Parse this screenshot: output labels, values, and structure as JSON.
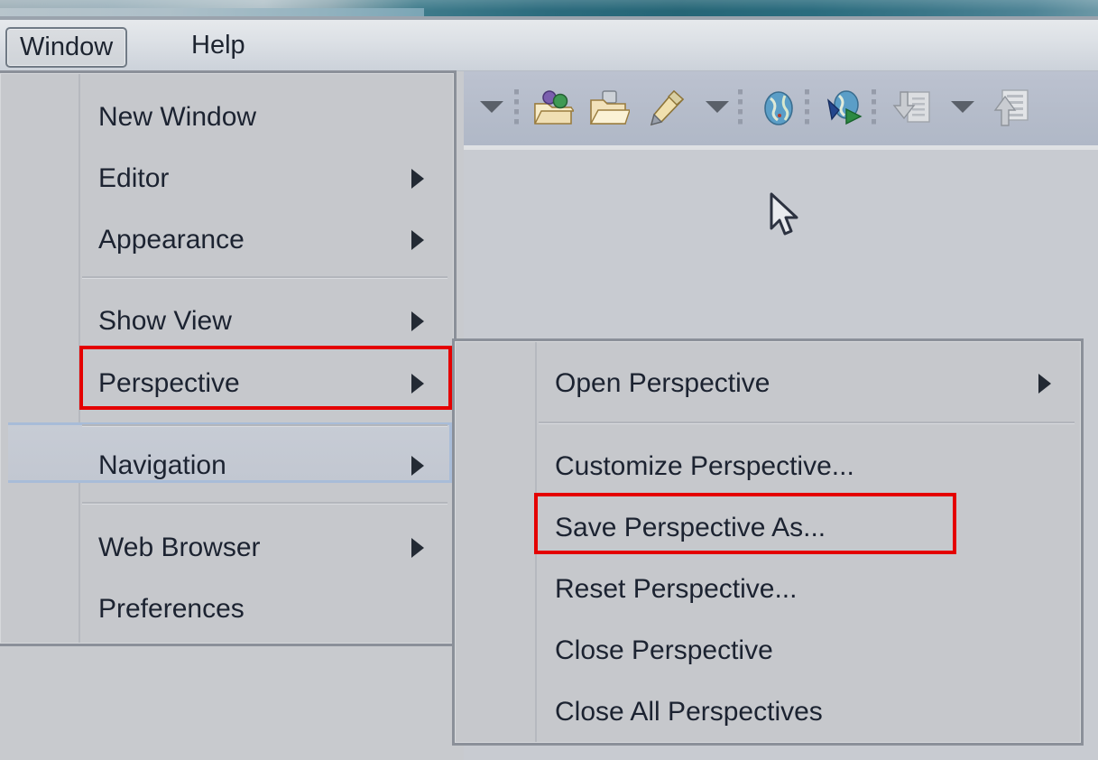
{
  "app": {
    "theme_bg": "#c8cace",
    "menu_bg": "#c6c8cc",
    "accent_highlight": "#a8bcd8",
    "annotation_color": "#e40000"
  },
  "menubar": {
    "items": [
      {
        "label": "Window",
        "active": true
      },
      {
        "label": "Help",
        "active": false
      }
    ]
  },
  "toolbar": {
    "items": [
      {
        "name": "dropdown-arrow-1",
        "icon": "chevron-down-icon"
      },
      {
        "name": "separator-1",
        "icon": "toolbar-separator"
      },
      {
        "name": "new-java-project",
        "icon": "package-folder-icon"
      },
      {
        "name": "new-folder",
        "icon": "open-folder-icon"
      },
      {
        "name": "new-file",
        "icon": "pencil-icon"
      },
      {
        "name": "dropdown-arrow-2",
        "icon": "chevron-down-icon"
      },
      {
        "name": "separator-2",
        "icon": "toolbar-separator"
      },
      {
        "name": "open-browser",
        "icon": "globe-icon"
      },
      {
        "name": "separator-3",
        "icon": "toolbar-separator"
      },
      {
        "name": "run-server",
        "icon": "globe-run-icon"
      },
      {
        "name": "separator-4",
        "icon": "toolbar-separator"
      },
      {
        "name": "import",
        "icon": "import-arrow-down-icon"
      },
      {
        "name": "dropdown-arrow-3",
        "icon": "chevron-down-icon"
      },
      {
        "name": "export",
        "icon": "export-arrow-up-icon"
      }
    ]
  },
  "window_menu": {
    "groups": [
      {
        "items": [
          {
            "label": "New Window",
            "submenu": false
          },
          {
            "label": "Editor",
            "submenu": true
          },
          {
            "label": "Appearance",
            "submenu": true
          }
        ]
      },
      {
        "items": [
          {
            "label": "Show View",
            "submenu": true
          },
          {
            "label": "Perspective",
            "submenu": true,
            "selected": true,
            "annotated": true
          }
        ]
      },
      {
        "items": [
          {
            "label": "Navigation",
            "submenu": true
          }
        ]
      },
      {
        "items": [
          {
            "label": "Web Browser",
            "submenu": true
          },
          {
            "label": "Preferences",
            "submenu": false
          }
        ]
      }
    ]
  },
  "perspective_submenu": {
    "groups": [
      {
        "items": [
          {
            "label": "Open Perspective",
            "submenu": true
          }
        ]
      },
      {
        "items": [
          {
            "label": "Customize Perspective...",
            "submenu": false
          },
          {
            "label": "Save Perspective As...",
            "submenu": false,
            "annotated": true
          },
          {
            "label": "Reset Perspective...",
            "submenu": false
          },
          {
            "label": "Close Perspective",
            "submenu": false
          },
          {
            "label": "Close All Perspectives",
            "submenu": false
          }
        ]
      }
    ]
  },
  "cursor": {
    "icon": "mouse-pointer-icon"
  }
}
